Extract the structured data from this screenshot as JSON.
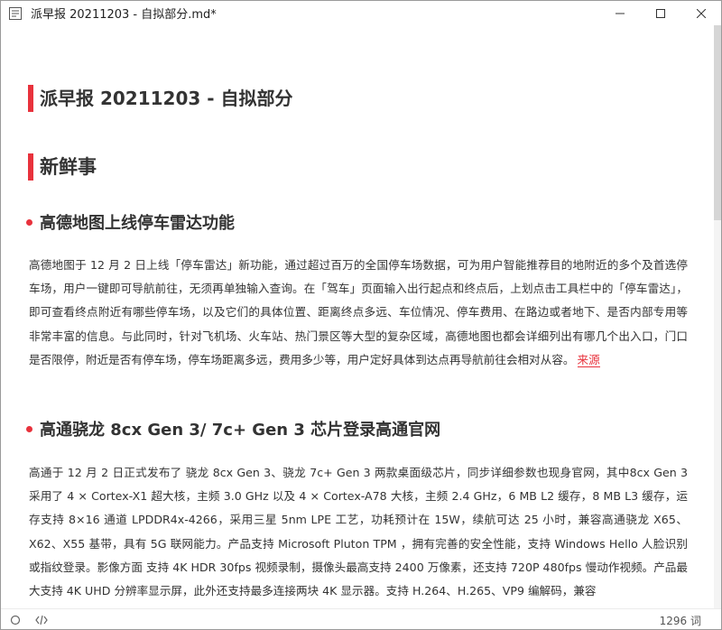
{
  "window": {
    "title": "派早报 20211203 - 自拟部分.md*",
    "icon": "app-icon"
  },
  "document": {
    "h1": "派早报 20211203 - 自拟部分",
    "h2": "新鲜事",
    "sections": [
      {
        "heading": "高德地图上线停车雷达功能",
        "body": "高德地图于 12 月 2 日上线「停车雷达」新功能，通过超过百万的全国停车场数据，可为用户智能推荐目的地附近的多个及首选停车场，用户一键即可导航前往，无须再单独输入查询。在「驾车」页面输入出行起点和终点后，上划点击工具栏中的「停车雷达」，即可查看终点附近有哪些停车场，以及它们的具体位置、距离终点多远、车位情况、停车费用、在路边或者地下、是否内部专用等非常丰富的信息。与此同时，针对飞机场、火车站、热门景区等大型的复杂区域，高德地图也都会详细列出有哪几个出入口，门口是否限停，附近是否有停车场，停车场距离多远，费用多少等，用户定好具体到达点再导航前往会相对从容。",
        "link": "来源"
      },
      {
        "heading": "高通骁龙 8cx Gen 3/ 7c+ Gen 3 芯片登录高通官网",
        "body": "高通于 12 月 2 日正式发布了 骁龙 8cx Gen 3、骁龙 7c+ Gen 3 两款桌面级芯片，同步详细参数也现身官网，其中8cx Gen 3 采用了 4 × Cortex-X1 超大核，主频 3.0 GHz 以及 4 × Cortex-A78 大核，主频 2.4 GHz，6 MB L2 缓存，8 MB L3 缓存，运存支持 8×16 通道 LPDDR4x-4266，采用三星 5nm LPE 工艺，功耗预计在 15W，续航可达 25 小时，兼容高通骁龙 X65、X62、X55 基带，具有 5G 联网能力。产品支持 Microsoft Pluton TPM ，拥有完善的安全性能，支持 Windows Hello 人脸识别或指纹登录。影像方面 支持 4K HDR 30fps 视频录制，摄像头最高支持 2400 万像素，还支持 720P 480fps 慢动作视频。产品最大支持 4K UHD 分辨率显示屏，此外还支持最多连接两块 4K 显示器。支持 H.264、H.265、VP9 编解码，兼容"
      }
    ]
  },
  "statusbar": {
    "word_count": "1296 词",
    "left_icons": [
      "circle-icon",
      "code-icon"
    ]
  },
  "colors": {
    "accent": "#e8323c",
    "text": "#333333"
  }
}
